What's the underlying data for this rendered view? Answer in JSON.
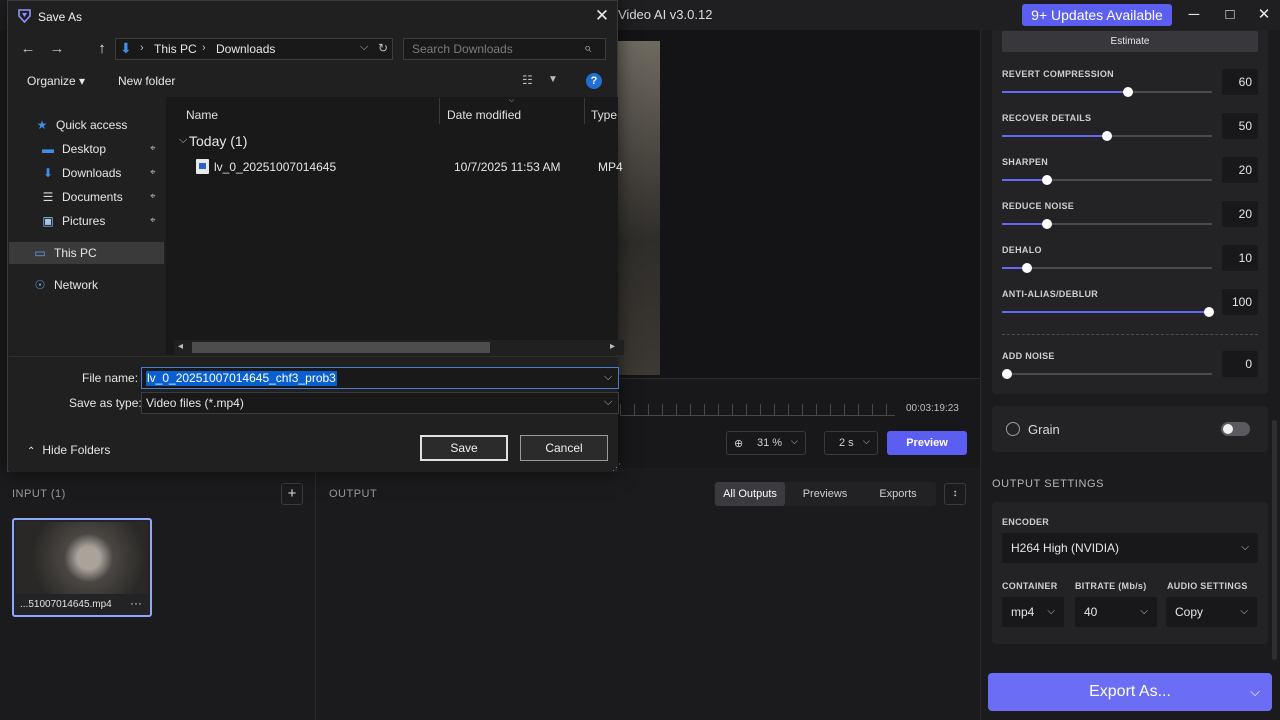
{
  "app": {
    "title": "Video AI  v3.0.12",
    "updates_label": "9+ Updates Available",
    "estimate_label": "Estimate",
    "sliders": [
      {
        "label": "REVERT COMPRESSION",
        "value": "60"
      },
      {
        "label": "RECOVER DETAILS",
        "value": "50"
      },
      {
        "label": "SHARPEN",
        "value": "20"
      },
      {
        "label": "REDUCE NOISE",
        "value": "20"
      },
      {
        "label": "DEHALO",
        "value": "10"
      },
      {
        "label": "ANTI-ALIAS/DEBLUR",
        "value": "100"
      },
      {
        "label": "ADD NOISE",
        "value": "0"
      }
    ],
    "grain_label": "Grain",
    "output_settings_title": "OUTPUT SETTINGS",
    "encoder_label": "ENCODER",
    "encoder_value": "H264 High (NVIDIA)",
    "container_label": "CONTAINER",
    "container_value": "mp4",
    "bitrate_label": "BITRATE (Mb/s)",
    "bitrate_value": "40",
    "audio_label": "AUDIO SETTINGS",
    "audio_value": "Copy",
    "export_label": "Export As...",
    "timecode": "00:03:19:23",
    "zoom_value": "31 %",
    "duration_value": "2 s",
    "preview_label": "Preview",
    "input_label": "INPUT (1)",
    "input_add": "+",
    "thumb_name": "...51007014645.mp4",
    "thumb_more": "···",
    "output_label": "OUTPUT",
    "output_tabs": [
      "All Outputs",
      "Previews",
      "Exports"
    ],
    "icons": {
      "minimize": "minimize-icon",
      "maximize": "maximize-icon",
      "close": "close-icon"
    },
    "accent": "#5b5ef0"
  },
  "dialog": {
    "title": "Save As",
    "breadcrumb": [
      "This PC",
      "Downloads"
    ],
    "search_placeholder": "Search Downloads",
    "organize_label": "Organize ▾",
    "new_folder_label": "New folder",
    "nav": [
      {
        "label": "Quick access"
      },
      {
        "label": "Desktop"
      },
      {
        "label": "Downloads"
      },
      {
        "label": "Documents"
      },
      {
        "label": "Pictures"
      },
      {
        "label": "This PC"
      },
      {
        "label": "Network"
      }
    ],
    "columns": [
      "Name",
      "Date modified",
      "Type"
    ],
    "group_label": "Today (1)",
    "file": {
      "name": "lv_0_20251007014645",
      "date": "10/7/2025 11:53 AM",
      "type": "MP4"
    },
    "file_name_label": "File name:",
    "file_name_value": "lv_0_20251007014645_chf3_prob3",
    "save_type_label": "Save as type:",
    "save_type_value": "Video files (*.mp4)",
    "hide_folders_label": "Hide Folders",
    "save_label": "Save",
    "cancel_label": "Cancel"
  }
}
